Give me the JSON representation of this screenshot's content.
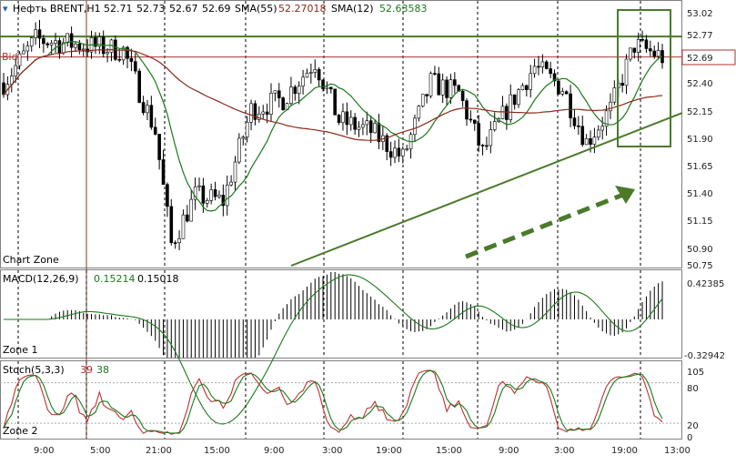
{
  "chart_data": [
    {
      "type": "candlestick",
      "panel": "main",
      "header": {
        "symbol": "Нефть BRENT,H1",
        "open": "52.71",
        "high": "52.73",
        "low": "52.67",
        "close": "52.69",
        "sma_slow_name": "SMA(55)",
        "sma_slow_value": "52.27018",
        "sma_fast_name": "SMA(12)",
        "sma_fast_value": "52.63583"
      },
      "bid_label": "Bid",
      "current_price": "52.69",
      "zone_label": "Chart Zone",
      "ylim": [
        50.75,
        53.05
      ],
      "yticks": [
        "53.02",
        "52.77",
        "52.40",
        "52.15",
        "51.90",
        "51.65",
        "51.40",
        "51.15",
        "50.90",
        "50.75"
      ],
      "resistance_level": 52.88,
      "trendline": [
        [
          0.43,
          50.75
        ],
        [
          1.0,
          52.17
        ]
      ],
      "colors": {
        "up": "#ffffff",
        "down": "#000000",
        "sma_fast": "#1a7a1a",
        "sma_slow": "#8b2a1a",
        "annotation": "#4a7a2a",
        "bid": "#b03030"
      }
    },
    {
      "type": "histogram",
      "panel": "macd",
      "title": "MACD(12,26,9)",
      "value_main": "0.15214",
      "value_signal": "0.15018",
      "zone_label": "Zone 1",
      "ymax_label": "0.42385",
      "ymin_label": "-0.32942",
      "ylim": [
        -0.32942,
        0.42385
      ]
    },
    {
      "type": "line",
      "panel": "stochastic",
      "title": "Stoch(5,3,3)",
      "value_k": "39",
      "value_d": "38",
      "zone_label": "Zone 2",
      "yticks": [
        "105",
        "80",
        "20",
        "0"
      ],
      "ylim": [
        0,
        105
      ]
    }
  ],
  "x_axis": {
    "labels": [
      "9:00",
      "5:00",
      "21:00",
      "15:00",
      "9:00",
      "3:00",
      "19:00",
      "15:00",
      "9:00",
      "3:00",
      "19:00",
      "13:00"
    ]
  }
}
